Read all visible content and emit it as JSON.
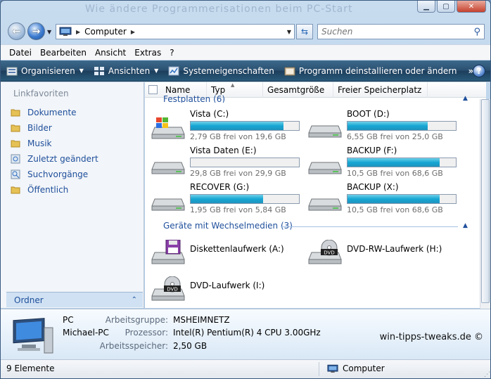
{
  "window": {
    "blurred_title": "Wie ändere Programmerisationen beim PC-Start"
  },
  "address": {
    "crumb": "Computer",
    "search_placeholder": "Suchen"
  },
  "menu": [
    "Datei",
    "Bearbeiten",
    "Ansicht",
    "Extras",
    "?"
  ],
  "toolbar": {
    "organisieren": "Organisieren",
    "ansichten": "Ansichten",
    "systemeigenschaften": "Systemeigenschaften",
    "programm": "Programm deinstallieren oder ändern",
    "more": "»",
    "help": "?"
  },
  "nav": {
    "header": "Linkfavoriten",
    "links": [
      "Dokumente",
      "Bilder",
      "Musik",
      "Zuletzt geändert",
      "Suchvorgänge",
      "Öffentlich"
    ],
    "ordner": "Ordner"
  },
  "columns": {
    "name": "Name",
    "typ": "Typ",
    "gesamt": "Gesamtgröße",
    "frei": "Freier Speicherplatz"
  },
  "groups": {
    "festplatten": "Festplatten (6)",
    "wechsel": "Geräte mit Wechselmedien (3)"
  },
  "drives": [
    {
      "name": "Vista (C:)",
      "info": "2,79 GB frei von 19,6 GB",
      "used_fraction": 0.86
    },
    {
      "name": "BOOT (D:)",
      "info": "6,55 GB frei von 25,0 GB",
      "used_fraction": 0.74
    },
    {
      "name": "Vista Daten (E:)",
      "info": "29,8 GB frei von 29,9 GB",
      "used_fraction": 0.003
    },
    {
      "name": "BACKUP (F:)",
      "info": "10,5 GB frei von 68,6 GB",
      "used_fraction": 0.85
    },
    {
      "name": "RECOVER (G:)",
      "info": "1,95 GB frei von 5,84 GB",
      "used_fraction": 0.67
    },
    {
      "name": "BACKUP (X:)",
      "info": "10,5 GB frei von 68,6 GB",
      "used_fraction": 0.85
    }
  ],
  "removable": [
    {
      "name": "Diskettenlaufwerk (A:)"
    },
    {
      "name": "DVD-RW-Laufwerk (H:)"
    },
    {
      "name": "DVD-Laufwerk (I:)"
    }
  ],
  "details": {
    "pc": "PC",
    "pcname": "Michael-PC",
    "arbeitsgruppe_label": "Arbeitsgruppe:",
    "arbeitsgruppe": "MSHEIMNETZ",
    "prozessor_label": "Prozessor:",
    "prozessor": "Intel(R) Pentium(R) 4 CPU 3.00GHz",
    "speicher_label": "Arbeitsspeicher:",
    "speicher": "2,50 GB",
    "watermark": "win-tipps-tweaks.de ©"
  },
  "status": {
    "count": "9 Elemente",
    "location": "Computer"
  }
}
